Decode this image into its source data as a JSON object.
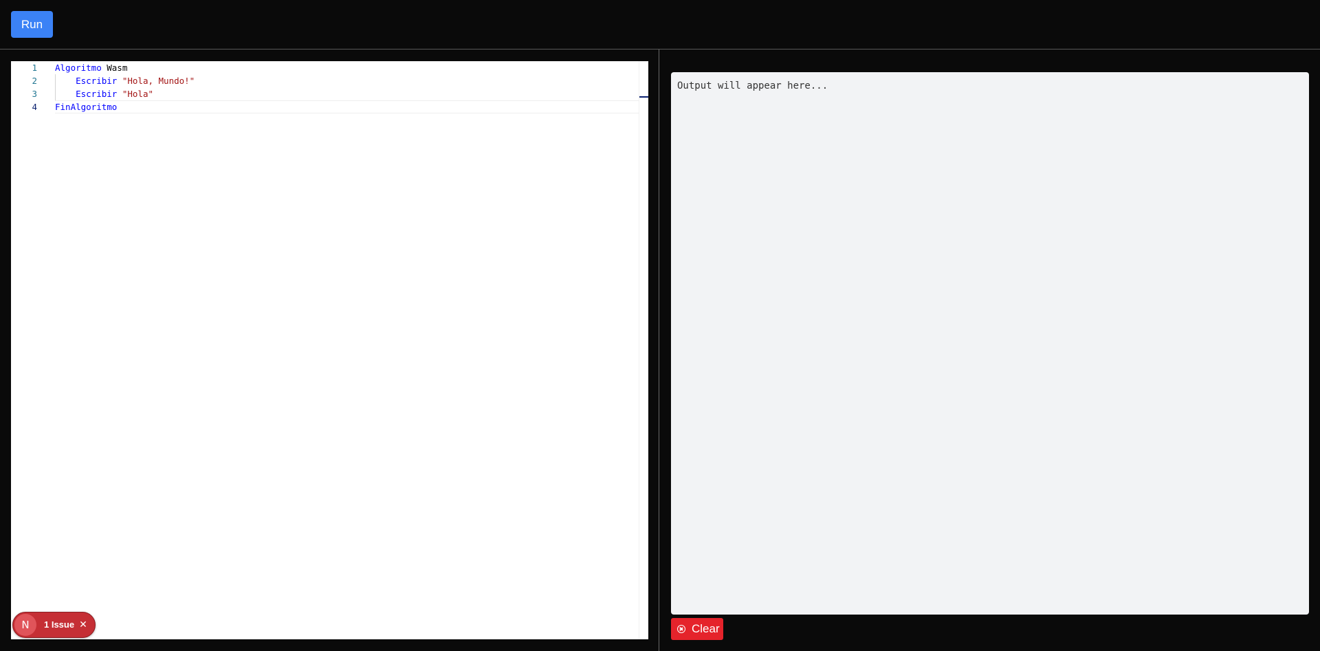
{
  "toolbar": {
    "run_label": "Run"
  },
  "editor": {
    "line_numbers": [
      "1",
      "2",
      "3",
      "4"
    ],
    "lines": [
      {
        "tokens": [
          {
            "text": "Algoritmo",
            "kind": "keyword"
          },
          {
            "text": " Wasm",
            "kind": "identifier"
          }
        ]
      },
      {
        "tokens": [
          {
            "text": "    Escribir",
            "kind": "keyword"
          },
          {
            "text": " \"Hola, Mundo!\"",
            "kind": "string"
          }
        ]
      },
      {
        "tokens": [
          {
            "text": "    Escribir",
            "kind": "keyword"
          },
          {
            "text": " \"Hola\"",
            "kind": "string"
          }
        ]
      },
      {
        "tokens": [
          {
            "text": "FinAlgoritmo",
            "kind": "keyword"
          }
        ]
      }
    ],
    "active_line": 4
  },
  "issue_badge": {
    "logo": "N",
    "label": "1 Issue",
    "close_glyph": "✕"
  },
  "output": {
    "placeholder": "Output will appear here..."
  },
  "clear_button": {
    "label": "Clear",
    "icon": "close-circle-icon"
  },
  "colors": {
    "background": "#0a0a0a",
    "run_button": "#3b82f6",
    "clear_button": "#e5232b",
    "issue_badge": "#c52f35",
    "keyword": "#0000ff",
    "string": "#a31515",
    "output_bg": "#f2f3f5"
  }
}
